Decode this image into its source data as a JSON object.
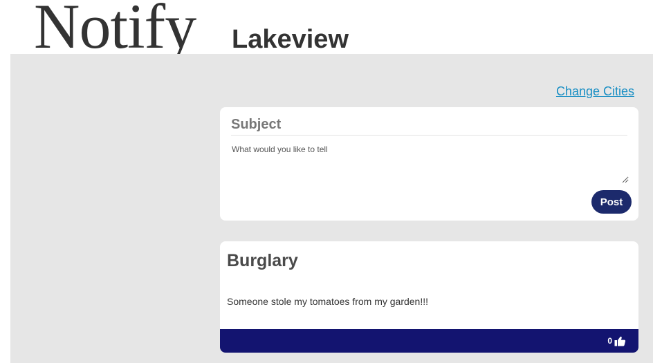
{
  "header": {
    "logo_text": "Notify",
    "city_name": "Lakeview"
  },
  "nav": {
    "change_cities_label": "Change Cities"
  },
  "compose": {
    "subject_placeholder": "Subject",
    "body_placeholder": "What would you like to tell",
    "post_button_label": "Post"
  },
  "posts": [
    {
      "title": "Burglary",
      "body": "Someone stole my tomatoes from my garden!!!",
      "likes": "0",
      "like_icon": "thumbs-up-icon"
    }
  ],
  "colors": {
    "page_background": "#e6e6e6",
    "link": "#1a8fc4",
    "post_button": "#1c2a6c",
    "card_footer": "#131470",
    "heading_text": "#333333"
  }
}
